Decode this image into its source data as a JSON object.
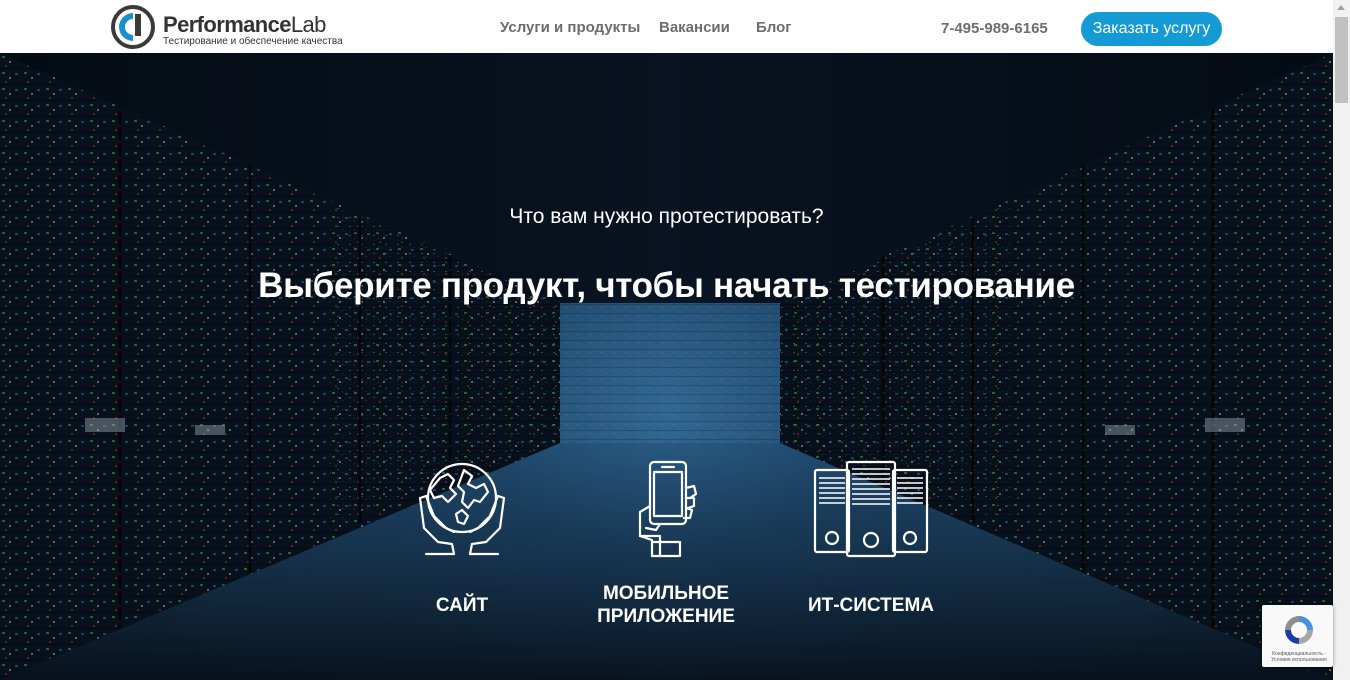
{
  "header": {
    "logo": {
      "brand_bold": "Performance",
      "brand_light": "Lab",
      "tagline": "Тестирование и обеспечение качества"
    },
    "nav": [
      {
        "label": "Услуги и продукты"
      },
      {
        "label": "Вакансии"
      },
      {
        "label": "Блог"
      }
    ],
    "phone": "7-495-989-6165",
    "order_button": "Заказать услугу"
  },
  "hero": {
    "subtitle": "Что вам нужно протестировать?",
    "title": "Выберите продукт, чтобы начать тестирование",
    "products": [
      {
        "label": "САЙТ",
        "icon": "globe-in-hands-icon"
      },
      {
        "label": "МОБИЛЬНОЕ ПРИЛОЖЕНИЕ",
        "icon": "phone-in-hand-icon"
      },
      {
        "label": "ИТ-СИСТЕМА",
        "icon": "servers-icon"
      }
    ]
  },
  "recaptcha": {
    "text": "Конфиденциальность - Условия использования"
  },
  "colors": {
    "accent": "#149bd6",
    "nav_text": "#6d6d6d",
    "hero_text": "#ffffff"
  }
}
